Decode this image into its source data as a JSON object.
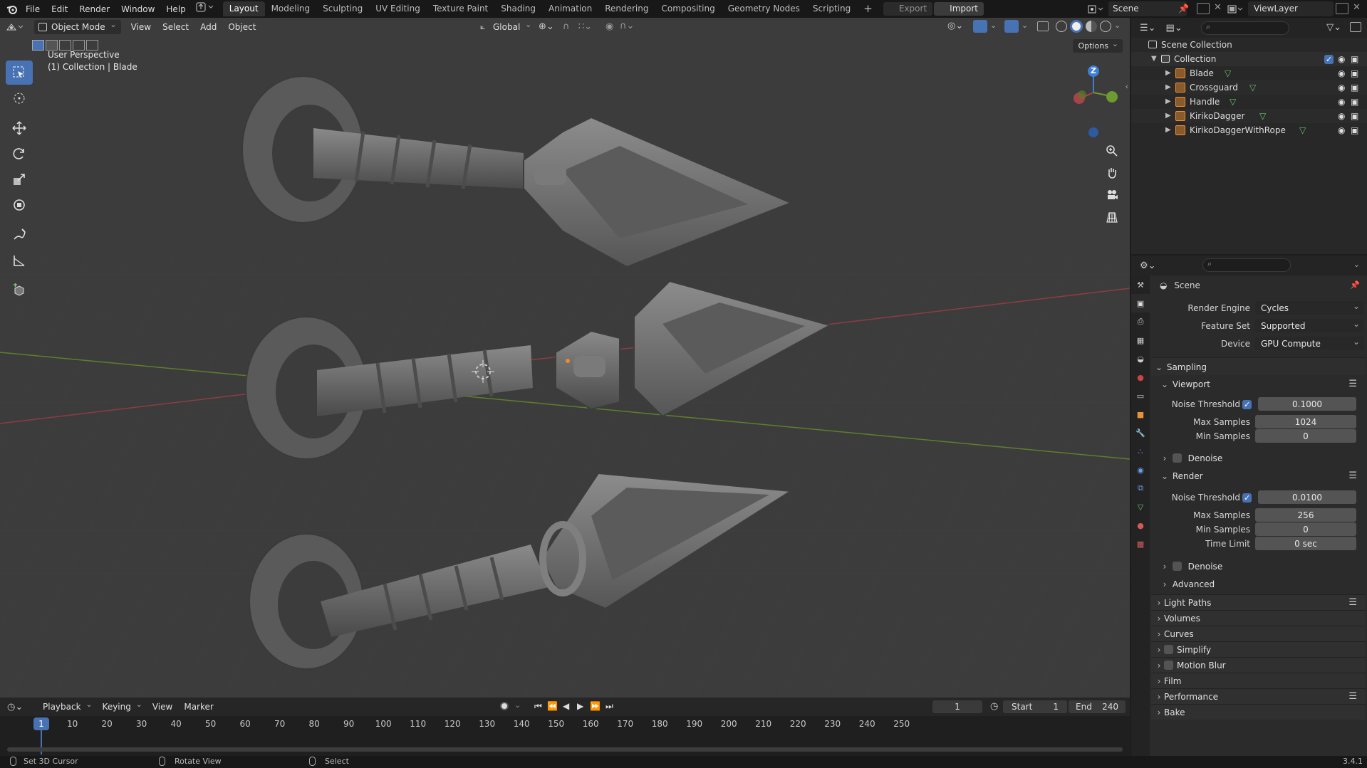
{
  "topbar": {
    "menus": [
      "File",
      "Edit",
      "Render",
      "Window",
      "Help"
    ],
    "workspaces": [
      "Layout",
      "Modeling",
      "Sculpting",
      "UV Editing",
      "Texture Paint",
      "Shading",
      "Animation",
      "Rendering",
      "Compositing",
      "Geometry Nodes",
      "Scripting"
    ],
    "active_workspace": "Layout",
    "export_label": "Export",
    "import_label": "Import",
    "scene_name": "Scene",
    "view_layer": "ViewLayer"
  },
  "viewport": {
    "mode": "Object Mode",
    "menus": [
      "View",
      "Select",
      "Add",
      "Object"
    ],
    "orientation": "Global",
    "options_label": "Options",
    "perspective_label": "User Perspective",
    "context_label": "(1) Collection | Blade",
    "gizmo_axis": "Z"
  },
  "timeline": {
    "menus": [
      "Playback",
      "Keying",
      "View",
      "Marker"
    ],
    "current_frame": "1",
    "start_label": "Start",
    "start_value": "1",
    "end_label": "End",
    "end_value": "240",
    "ruler": [
      "1",
      "10",
      "20",
      "30",
      "40",
      "50",
      "60",
      "70",
      "80",
      "90",
      "100",
      "110",
      "120",
      "130",
      "140",
      "150",
      "160",
      "170",
      "180",
      "190",
      "200",
      "210",
      "220",
      "230",
      "240",
      "250"
    ]
  },
  "statusbar": {
    "items": [
      "Set 3D Cursor",
      "Rotate View",
      "Select"
    ],
    "version": "3.4.1"
  },
  "outliner": {
    "scene_collection": "Scene Collection",
    "collection": "Collection",
    "objects": [
      "Blade",
      "Crossguard",
      "Handle",
      "KirikoDagger",
      "KirikoDaggerWithRope"
    ]
  },
  "properties": {
    "title": "Scene",
    "render_engine_label": "Render Engine",
    "render_engine": "Cycles",
    "feature_set_label": "Feature Set",
    "feature_set": "Supported",
    "device_label": "Device",
    "device": "GPU Compute",
    "sampling": "Sampling",
    "viewport_sub": "Viewport",
    "render_sub": "Render",
    "noise_threshold_label": "Noise Threshold",
    "viewport_noise": "0.1000",
    "max_samples_label": "Max Samples",
    "viewport_max": "1024",
    "min_samples_label": "Min Samples",
    "viewport_min": "0",
    "denoise_label": "Denoise",
    "render_noise": "0.0100",
    "render_max": "256",
    "render_min": "0",
    "time_limit_label": "Time Limit",
    "time_limit": "0 sec",
    "advanced_label": "Advanced",
    "panels": [
      "Light Paths",
      "Volumes",
      "Curves",
      "Simplify",
      "Motion Blur",
      "Film",
      "Performance",
      "Bake"
    ]
  },
  "colors": {
    "accent": "#4772b3",
    "viewport_bg": "#3c3c3c",
    "x_axis": "#a8424c",
    "y_axis": "#6e9a2f",
    "z_axis": "#3d7fd6"
  }
}
